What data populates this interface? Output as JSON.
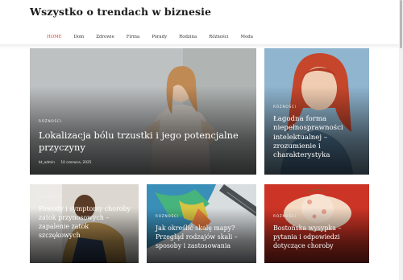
{
  "site": {
    "title": "Wszystko o trendach w biznesie"
  },
  "nav": {
    "items": [
      "HOME",
      "Dom",
      "Zdrowie",
      "Firma",
      "Porady",
      "Rodzina",
      "Różności",
      "Moda"
    ]
  },
  "featured": {
    "category": "RÓŻNOŚCI",
    "title": "Lokalizacja bólu trzustki i jego potencjalne przyczyny",
    "author": "bt_admin",
    "date": "10 czerwca, 2025"
  },
  "side_card": {
    "category": "RÓŻNOŚCI",
    "title": "Łagodna forma niepełnosprawności intelektualnej – zrozumienie i charakterystyka"
  },
  "cards": [
    {
      "category": "RÓŻNOŚCI",
      "title": "Powody i symptomy choroby zatok przynosowych – zapalenie zatok szczękowych"
    },
    {
      "category": "RÓŻNOŚCI",
      "title": "Jak określić skalę mapy? Przegląd rodzajów skali – sposoby i zastosowania"
    },
    {
      "category": "RÓŻNOŚCI",
      "title": "Bostońska wysypka – pytania i odpowiedzi dotyczące choroby"
    }
  ],
  "colors": {
    "nav_active": "#d94427",
    "title_text": "#1a1a1a"
  }
}
